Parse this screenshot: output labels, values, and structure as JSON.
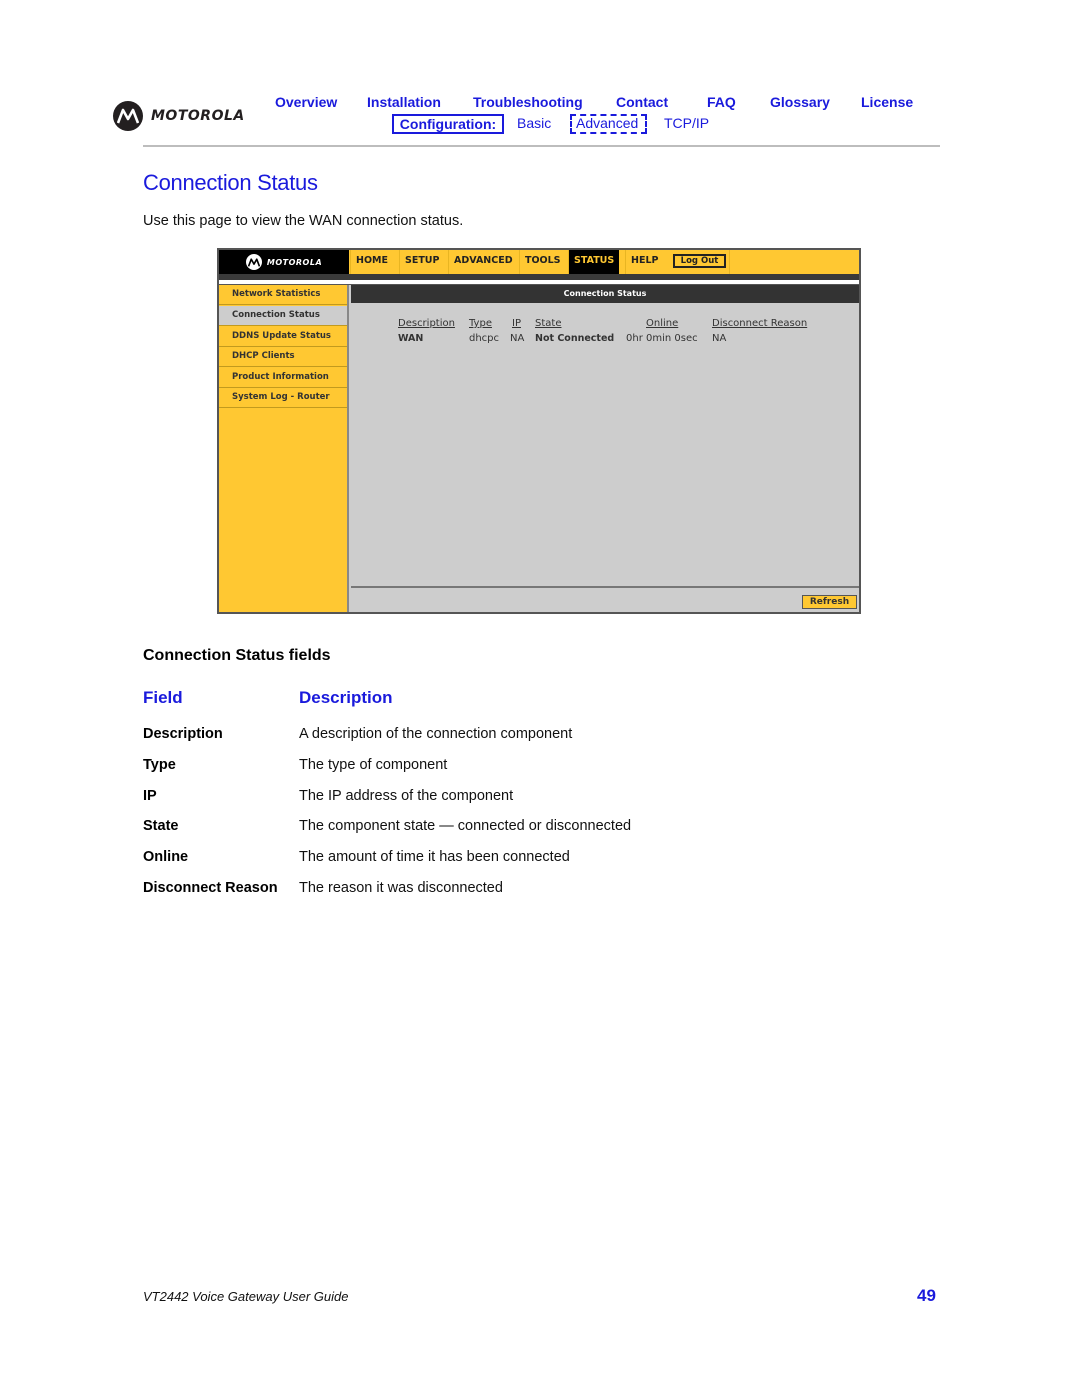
{
  "brand": {
    "name": "MOTOROLA",
    "logo_icon": "motorola-batwing-icon"
  },
  "top_nav": [
    {
      "label": "Overview"
    },
    {
      "label": "Installation"
    },
    {
      "label": "Troubleshooting"
    },
    {
      "label": "Contact"
    },
    {
      "label": "FAQ"
    },
    {
      "label": "Glossary"
    },
    {
      "label": "License"
    }
  ],
  "sub_nav": {
    "section_label": "Configuration:",
    "links": [
      {
        "label": "Basic"
      },
      {
        "label": "Advanced",
        "current": true
      },
      {
        "label": "TCP/IP"
      }
    ]
  },
  "page": {
    "title": "Connection Status",
    "intro": "Use this page to view the WAN connection status."
  },
  "router_ui": {
    "brand": "MOTOROLA",
    "tabs": [
      {
        "label": "HOME"
      },
      {
        "label": "SETUP"
      },
      {
        "label": "ADVANCED"
      },
      {
        "label": "TOOLS"
      },
      {
        "label": "STATUS",
        "active": true
      },
      {
        "label": "HELP"
      }
    ],
    "logout_label": "Log Out",
    "sidebar": [
      {
        "label": "Network Statistics"
      },
      {
        "label": "Connection Status",
        "active": true
      },
      {
        "label": "DDNS Update Status"
      },
      {
        "label": "DHCP Clients"
      },
      {
        "label": "Product Information"
      },
      {
        "label": "System Log - Router"
      }
    ],
    "section_title": "Connection Status",
    "table": {
      "headers": [
        "Description",
        "Type",
        "IP",
        "State",
        "Online",
        "Disconnect Reason"
      ],
      "rows": [
        [
          "WAN",
          "dhcpc",
          "NA",
          "Not Connected",
          "0hr 0min 0sec",
          "NA"
        ]
      ]
    },
    "refresh_label": "Refresh",
    "colors": {
      "accent": "#ffc832",
      "dark": "#333333",
      "panel": "#cdcdcd"
    }
  },
  "fields_section": {
    "heading": "Connection Status fields",
    "col_field": "Field",
    "col_description": "Description",
    "rows": [
      {
        "field": "Description",
        "description": "A description of the connection component"
      },
      {
        "field": "Type",
        "description": "The type of component"
      },
      {
        "field": "IP",
        "description": "The IP address of the component"
      },
      {
        "field": "State",
        "description": "The component state — connected or disconnected"
      },
      {
        "field": "Online",
        "description": "The amount of time it has been connected"
      },
      {
        "field": "Disconnect Reason",
        "description": "The reason it was disconnected"
      }
    ]
  },
  "footer": {
    "guide_title": "VT2442 Voice Gateway User Guide",
    "page_number": "49"
  },
  "colors": {
    "link_blue": "#1a1adc",
    "rule_gray": "#bdbdbd"
  }
}
